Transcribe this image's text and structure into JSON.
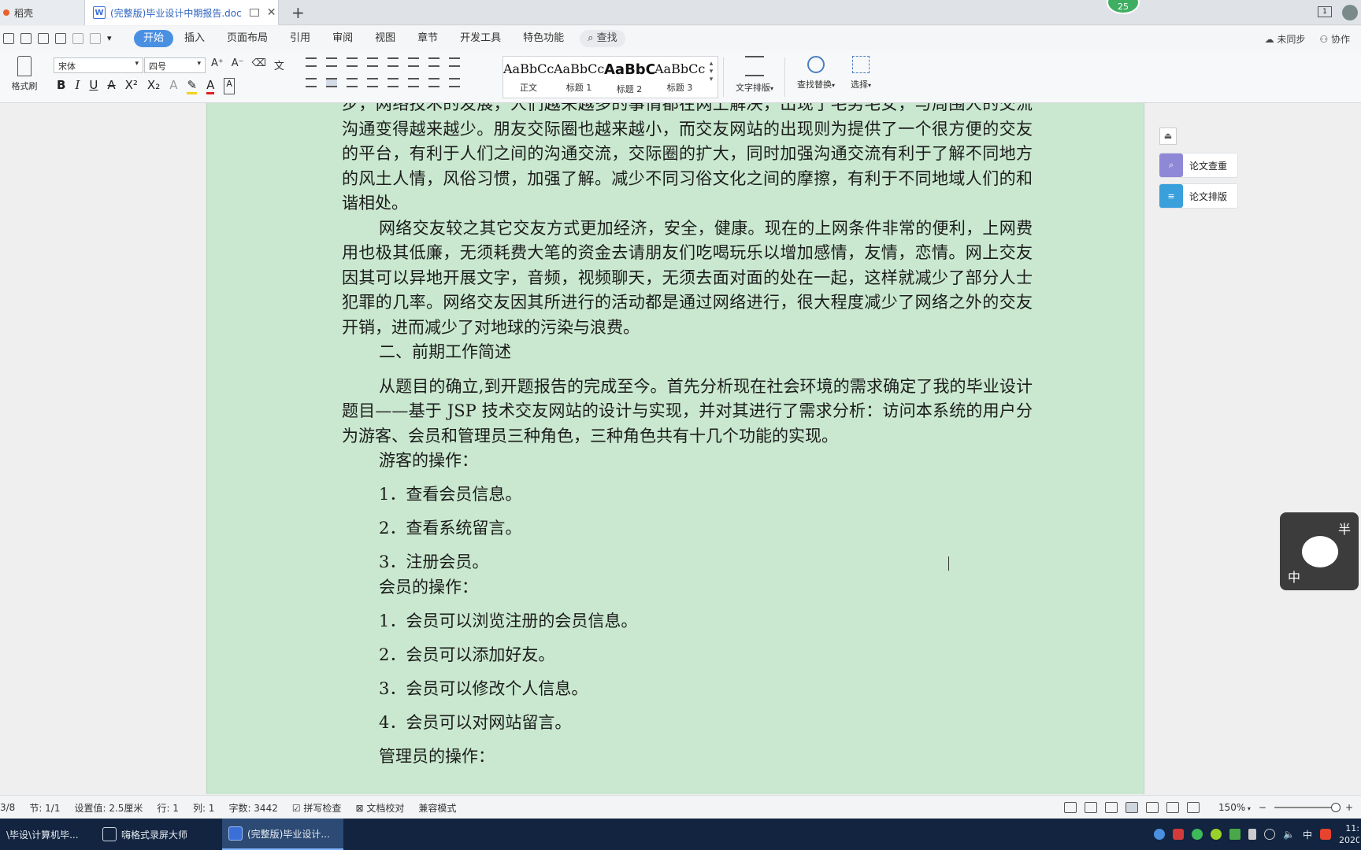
{
  "tabs": {
    "dao_label": "稻壳",
    "doc_title": "(完整版)毕业设计中期报告.doc",
    "new_tab": "+",
    "badge_count": "25",
    "window_count": "1"
  },
  "menu": {
    "items": [
      "开始",
      "插入",
      "页面布局",
      "引用",
      "审阅",
      "视图",
      "章节",
      "开发工具",
      "特色功能"
    ],
    "search_label": "查找",
    "sync_label": "未同步",
    "collab_label": "协作"
  },
  "ribbon": {
    "format_painter": "格式刷",
    "font_name": "宋体",
    "font_size": "四号",
    "styles": [
      {
        "preview": "AaBbCcDd",
        "label": "正文"
      },
      {
        "preview": "AaBbCc",
        "label": "标题 1"
      },
      {
        "preview": "AaBbC",
        "label": "标题 2"
      },
      {
        "preview": "AaBbCc",
        "label": "标题 3"
      }
    ],
    "text_layout": "文字排版",
    "find_replace": "查找替换",
    "select": "选择"
  },
  "document": {
    "p1": "步，网络技术的发展，人们越来越多的事情都在网上解决，出现了宅男宅女，与周围人的交流沟通变得越来越少。朋友交际圈也越来越小，而交友网站的出现则为提供了一个很方便的交友的平台，有利于人们之间的沟通交流，交际圈的扩大，同时加强沟通交流有利于了解不同地方的风土人情，风俗习惯，加强了解。减少不同习俗文化之间的摩擦，有利于不同地域人们的和谐相处。",
    "p2": "网络交友较之其它交友方式更加经济，安全，健康。现在的上网条件非常的便利，上网费用也极其低廉，无须耗费大笔的资金去请朋友们吃喝玩乐以增加感情，友情，恋情。网上交友因其可以异地开展文字，音频，视频聊天，无须去面对面的处在一起，这样就减少了部分人士犯罪的几率。网络交友因其所进行的活动都是通过网络进行，很大程度减少了网络之外的交友开销，进而减少了对地球的污染与浪费。",
    "heading2": "二、前期工作简述",
    "p3": "从题目的确立,到开题报告的完成至今。首先分析现在社会环境的需求确定了我的毕业设计题目——基于 JSP 技术交友网站的设计与实现，并对其进行了需求分析：访问本系统的用户分为游客、会员和管理员三种角色，三种角色共有十几个功能的实现。",
    "guest_title": "游客的操作：",
    "guest_items": [
      "1．查看会员信息。",
      "2．查看系统留言。",
      "3．注册会员。"
    ],
    "member_title": "会员的操作：",
    "member_items": [
      "1．会员可以浏览注册的会员信息。",
      "2．会员可以添加好友。",
      "3．会员可以修改个人信息。",
      "4．会员可以对网站留言。"
    ],
    "admin_title": "管理员的操作："
  },
  "side_panel": {
    "check": "论文查重",
    "layout": "论文排版"
  },
  "sticker": {
    "t1": "半",
    "t2": "中"
  },
  "status": {
    "page": "3/8",
    "section": "节: 1/1",
    "setting": "设置值: 2.5厘米",
    "row": "行: 1",
    "col": "列: 1",
    "words": "字数: 3442",
    "spell": "拼写检查",
    "proof": "文档校对",
    "compat": "兼容模式",
    "zoom": "150%"
  },
  "taskbar": {
    "items": [
      "\\毕设\\计算机毕...",
      "嗨格式录屏大师",
      "(完整版)毕业设计..."
    ],
    "ime": "中",
    "time": "11:",
    "date": "2020"
  }
}
